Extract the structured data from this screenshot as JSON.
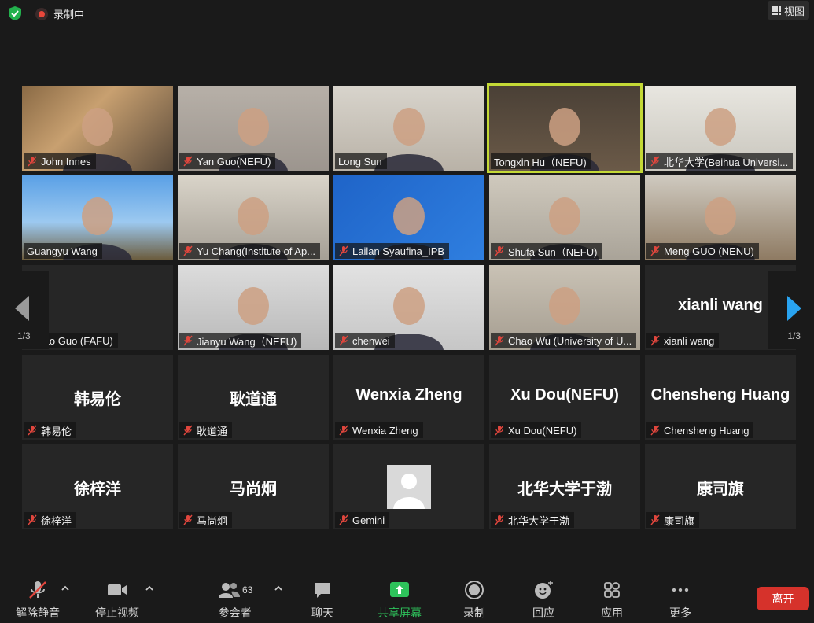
{
  "topbar": {
    "recording_label": "录制中",
    "view_label": "视图"
  },
  "gallery": {
    "tiles": [
      {
        "name": "John Innes",
        "muted": true,
        "video": true
      },
      {
        "name": "Yan Guo(NEFU)",
        "muted": true,
        "video": true
      },
      {
        "name": "Long Sun",
        "muted": false,
        "video": true
      },
      {
        "name": "Tongxin Hu（NEFU)",
        "muted": false,
        "video": true,
        "speaking": true
      },
      {
        "name": "北华大学(Beihua Universi...",
        "muted": true,
        "video": true
      },
      {
        "name": "Guangyu Wang",
        "muted": false,
        "video": true
      },
      {
        "name": "Yu Chang(Institute of Ap...",
        "muted": true,
        "video": true
      },
      {
        "name": "Lailan Syaufina_IPB",
        "muted": true,
        "video": true
      },
      {
        "name": "Shufa Sun（NEFU)",
        "muted": true,
        "video": true
      },
      {
        "name": "Meng GUO (NENU)",
        "muted": true,
        "video": true
      },
      {
        "name": "...utao Guo (FAFU)",
        "muted": false,
        "video": false
      },
      {
        "name": "Jianyu Wang（NEFU)",
        "muted": true,
        "video": true
      },
      {
        "name": "chenwei",
        "muted": true,
        "video": true
      },
      {
        "name": "Chao Wu (University of U...",
        "muted": true,
        "video": true
      },
      {
        "name": "xianli wang",
        "big": "xianli wang",
        "muted": true,
        "video": false
      },
      {
        "name": "韩易伦",
        "big": "韩易伦",
        "muted": true,
        "video": false
      },
      {
        "name": "耿道通",
        "big": "耿道通",
        "muted": true,
        "video": false
      },
      {
        "name": "Wenxia Zheng",
        "big": "Wenxia Zheng",
        "muted": true,
        "video": false
      },
      {
        "name": "Xu Dou(NEFU)",
        "big": "Xu Dou(NEFU)",
        "muted": true,
        "video": false
      },
      {
        "name": "Chensheng Huang",
        "big": "Chensheng Huang",
        "muted": true,
        "video": false
      },
      {
        "name": "徐梓洋",
        "big": "徐梓洋",
        "muted": true,
        "video": false
      },
      {
        "name": "马尚炯",
        "big": "马尚炯",
        "muted": true,
        "video": false
      },
      {
        "name": "Gemini",
        "muted": true,
        "video": false,
        "avatar": true
      },
      {
        "name": "北华大学于渤",
        "big": "北华大学于渤",
        "muted": true,
        "video": false
      },
      {
        "name": "康司旗",
        "big": "康司旗",
        "muted": true,
        "video": false
      }
    ],
    "page_prev": "1/3",
    "page_next": "1/3"
  },
  "toolbar": {
    "unmute": "解除静音",
    "stop_video": "停止视频",
    "participants": "参会者",
    "participant_count": "63",
    "chat": "聊天",
    "share": "共享屏幕",
    "record": "录制",
    "reactions": "回应",
    "apps": "应用",
    "more": "更多",
    "leave": "离开"
  },
  "colors": {
    "background": "#1a1a1a",
    "tile": "#262626",
    "speaking_border": "#c4d936",
    "share_green": "#2ec25b",
    "leave_red": "#d6322b",
    "next_arrow": "#29a3f0",
    "mute_red": "#e0463d"
  }
}
